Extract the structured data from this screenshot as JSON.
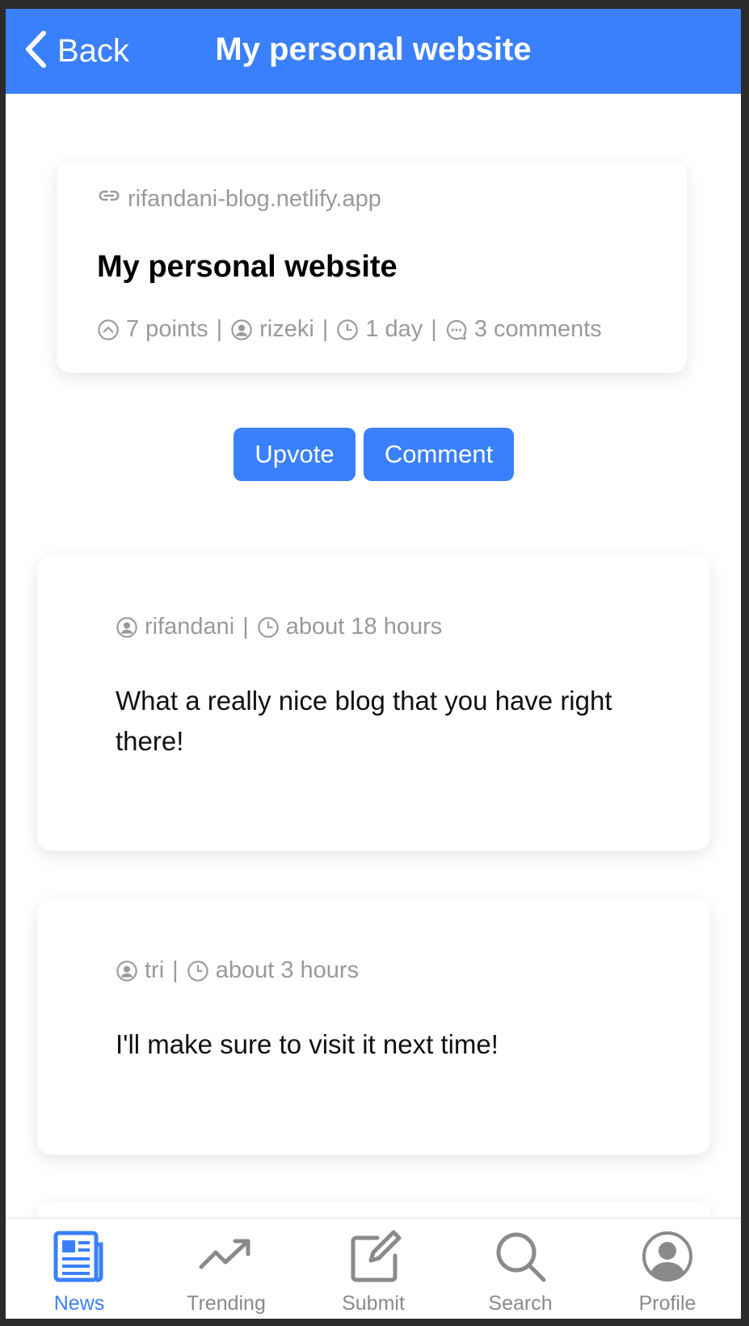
{
  "header": {
    "back_label": "Back",
    "title": "My personal website"
  },
  "story": {
    "domain": "rifandani-blog.netlify.app",
    "title": "My personal website",
    "points": "7 points",
    "author": "rizeki",
    "age": "1 day",
    "comments": "3 comments"
  },
  "actions": {
    "upvote_label": "Upvote",
    "comment_label": "Comment"
  },
  "comments": [
    {
      "author": "rifandani",
      "age": "about 18 hours",
      "text": "What a really nice blog that you have right there!"
    },
    {
      "author": "tri",
      "age": "about 3 hours",
      "text": "I'll make sure to visit it next time!"
    }
  ],
  "nav": {
    "active": "News",
    "items": [
      {
        "label": "News",
        "icon": "newspaper-icon"
      },
      {
        "label": "Trending",
        "icon": "trending-icon"
      },
      {
        "label": "Submit",
        "icon": "edit-icon"
      },
      {
        "label": "Search",
        "icon": "search-icon"
      },
      {
        "label": "Profile",
        "icon": "user-circle-icon"
      }
    ]
  },
  "colors": {
    "accent": "#3a80fd",
    "muted_text": "#9a9a9a",
    "background": "#ffffff"
  }
}
